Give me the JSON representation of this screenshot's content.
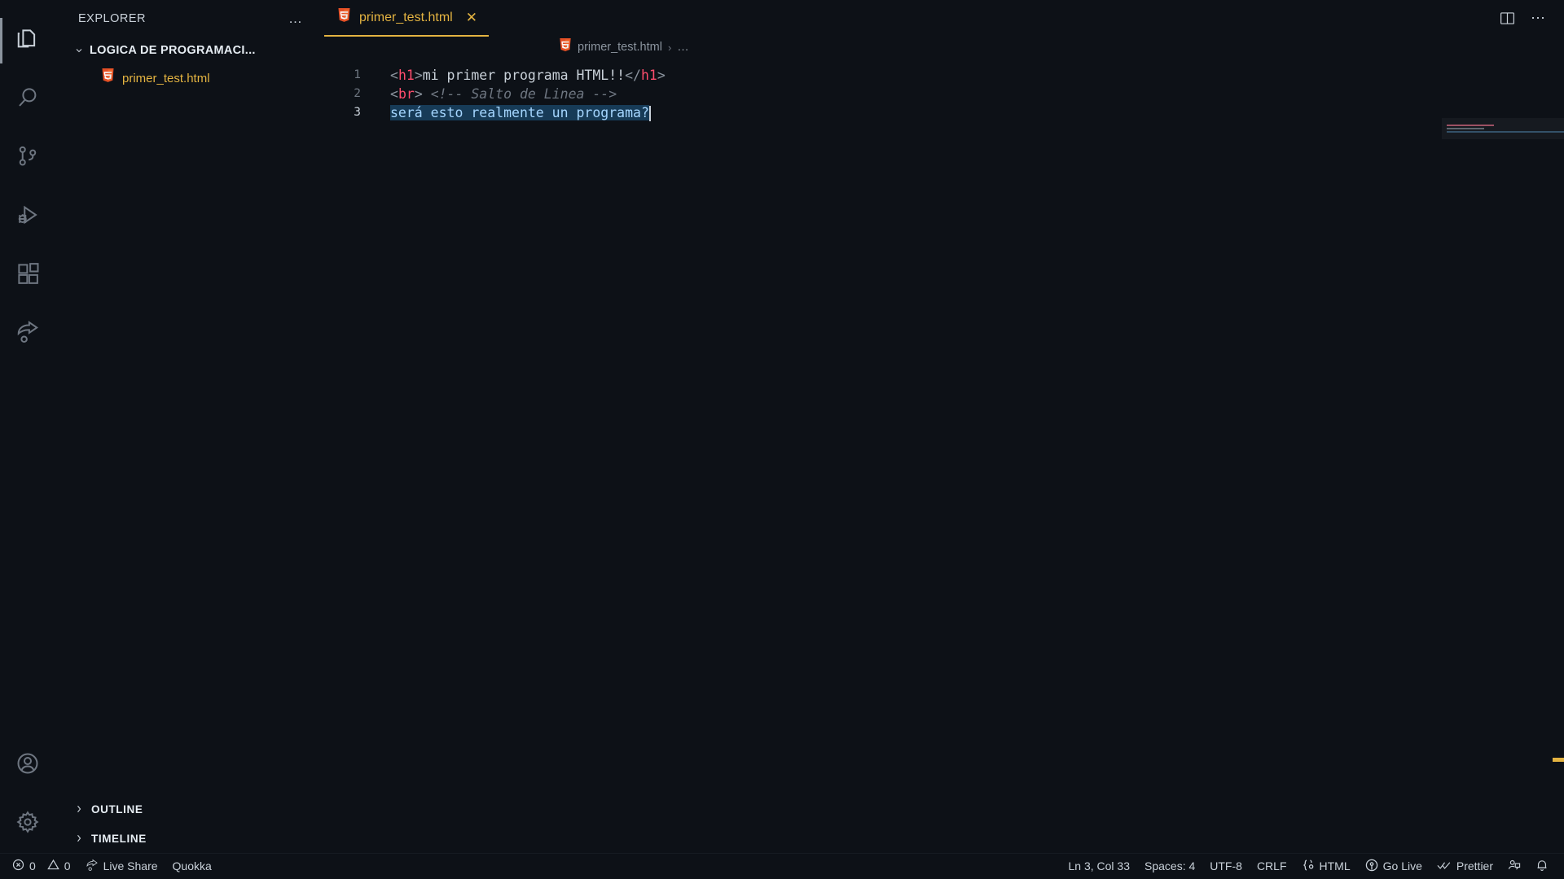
{
  "activity_bar": {
    "items": [
      {
        "name": "explorer",
        "label": "Explorer",
        "icon": "files-icon",
        "active": true
      },
      {
        "name": "search",
        "label": "Search",
        "icon": "search-icon",
        "active": false
      },
      {
        "name": "source-control",
        "label": "Source Control",
        "icon": "source-control-icon",
        "active": false
      },
      {
        "name": "run-debug",
        "label": "Run and Debug",
        "icon": "run-debug-icon",
        "active": false
      },
      {
        "name": "extensions",
        "label": "Extensions",
        "icon": "extensions-icon",
        "active": false
      },
      {
        "name": "live-share",
        "label": "Live Share",
        "icon": "live-share-icon",
        "active": false
      }
    ],
    "bottom_items": [
      {
        "name": "accounts",
        "label": "Accounts",
        "icon": "account-icon"
      },
      {
        "name": "manage",
        "label": "Manage",
        "icon": "gear-icon"
      }
    ]
  },
  "sidebar": {
    "title": "EXPLORER",
    "more_actions": "…",
    "folder": {
      "name": "LOGICA DE PROGRAMACI...",
      "expanded": true,
      "chevron": "⌄"
    },
    "files": [
      {
        "name": "primer_test.html",
        "icon": "html5-icon"
      }
    ],
    "sections": [
      {
        "name": "OUTLINE",
        "chevron": "›",
        "expanded": false
      },
      {
        "name": "TIMELINE",
        "chevron": "›",
        "expanded": false
      }
    ]
  },
  "tabs": [
    {
      "label": "primer_test.html",
      "icon": "html5-icon",
      "close": "✕",
      "active": true
    }
  ],
  "editor_actions": {
    "split_editor": "split-editor-icon",
    "more_actions": "⋯"
  },
  "breadcrumbs": {
    "items": [
      "primer_test.html",
      "…"
    ],
    "separator": "›"
  },
  "code": {
    "language": "HTML",
    "lines": [
      {
        "number": "1",
        "tokens": [
          {
            "t": "<",
            "c": "punc"
          },
          {
            "t": "h1",
            "c": "tag"
          },
          {
            "t": ">",
            "c": "punc"
          },
          {
            "t": "mi primer programa HTML!!",
            "c": "text"
          },
          {
            "t": "</",
            "c": "punc"
          },
          {
            "t": "h1",
            "c": "tag"
          },
          {
            "t": ">",
            "c": "punc"
          }
        ]
      },
      {
        "number": "2",
        "tokens": [
          {
            "t": "<",
            "c": "punc"
          },
          {
            "t": "br",
            "c": "tag"
          },
          {
            "t": ">",
            "c": "punc"
          },
          {
            "t": " ",
            "c": "text"
          },
          {
            "t": "<!-- Salto de Linea -->",
            "c": "cmt"
          }
        ]
      },
      {
        "number": "3",
        "current": true,
        "selected": true,
        "tokens": [
          {
            "t": "será esto realmente un programa?",
            "c": "plain"
          }
        ]
      }
    ]
  },
  "status_bar": {
    "left": [
      {
        "name": "problems",
        "icon": "error-icon",
        "label": "0"
      },
      {
        "name": "warnings",
        "icon": "warning-icon",
        "label": "0"
      },
      {
        "name": "live-share",
        "icon": "live-share-icon",
        "label": "Live Share"
      },
      {
        "name": "quokka",
        "icon": "",
        "label": "Quokka"
      }
    ],
    "right": [
      {
        "name": "cursor-position",
        "icon": "",
        "label": "Ln 3, Col 33"
      },
      {
        "name": "indentation",
        "icon": "",
        "label": "Spaces: 4"
      },
      {
        "name": "encoding",
        "icon": "",
        "label": "UTF-8"
      },
      {
        "name": "eol",
        "icon": "",
        "label": "CRLF"
      },
      {
        "name": "language-mode",
        "icon": "braces-icon",
        "label": "HTML"
      },
      {
        "name": "go-live",
        "icon": "broadcast-icon",
        "label": "Go Live"
      },
      {
        "name": "prettier",
        "icon": "checks-icon",
        "label": "Prettier"
      },
      {
        "name": "feedback",
        "icon": "feedback-icon",
        "label": ""
      },
      {
        "name": "notifications",
        "icon": "bell-icon",
        "label": ""
      }
    ]
  },
  "colors": {
    "background": "#0d1117",
    "accent_yellow": "#e3b341",
    "tag_pink": "#ff4d6d",
    "string_blue": "#a5d6ff",
    "comment_gray": "#6e7681",
    "selection": "#173b57",
    "foreground": "#c9d1d9"
  }
}
